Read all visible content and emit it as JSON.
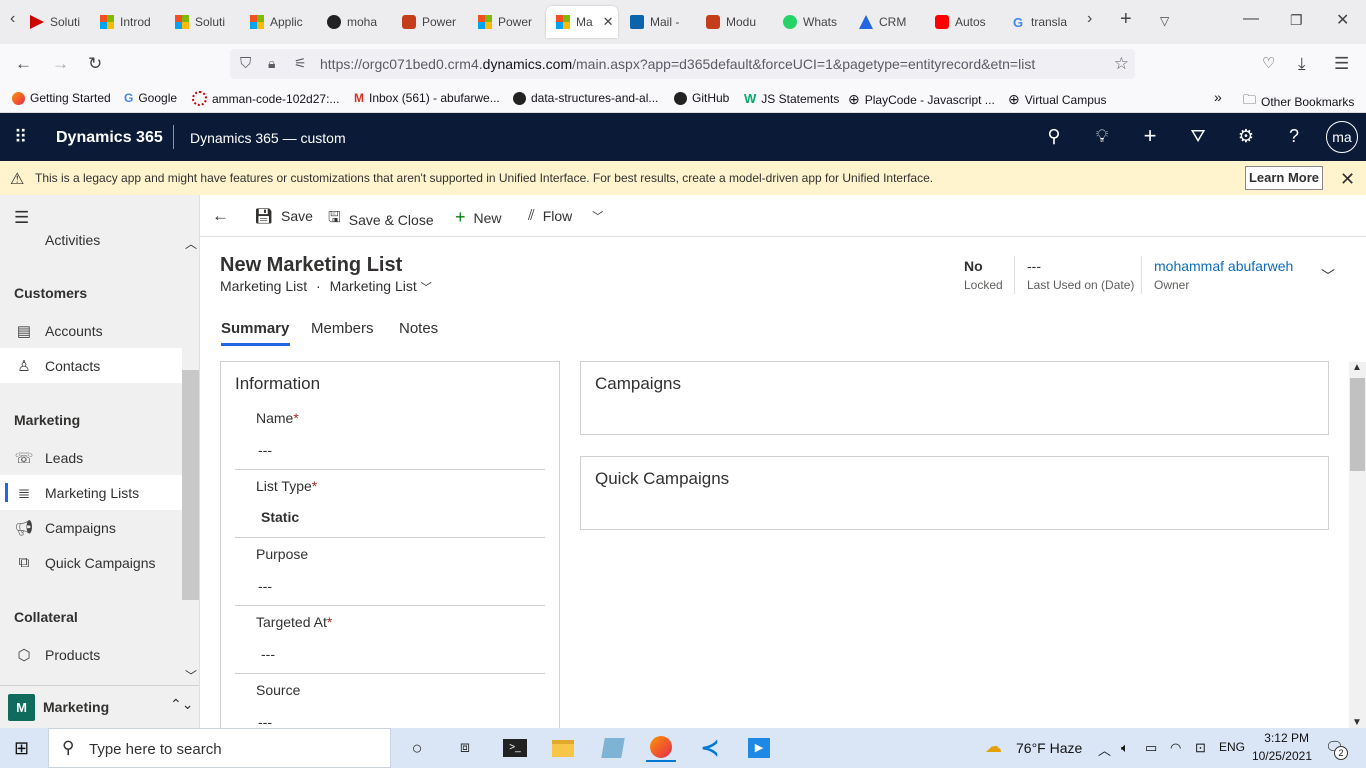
{
  "browser": {
    "tabs": [
      {
        "label": "Soluti",
        "icon": "powerapps-icon"
      },
      {
        "label": "Introd",
        "icon": "microsoft-icon"
      },
      {
        "label": "Soluti",
        "icon": "microsoft-icon"
      },
      {
        "label": "Applic",
        "icon": "microsoft-icon"
      },
      {
        "label": "moha",
        "icon": "github-icon"
      },
      {
        "label": "Power",
        "icon": "powerpoint-icon"
      },
      {
        "label": "Power",
        "icon": "microsoft-icon"
      },
      {
        "label": "Ma",
        "icon": "microsoft-icon",
        "active": true
      },
      {
        "label": "Mail -",
        "icon": "outlook-icon"
      },
      {
        "label": "Modu",
        "icon": "powerpoint-icon"
      },
      {
        "label": "Whats",
        "icon": "whatsapp-icon"
      },
      {
        "label": "CRM",
        "icon": "crm-icon"
      },
      {
        "label": "Autos",
        "icon": "youtube-icon"
      },
      {
        "label": "transla",
        "icon": "google-icon"
      }
    ],
    "url_prefix": "https://orgc071bed0.crm4.",
    "url_domain": "dynamics.com",
    "url_path": "/main.aspx?app=d365default&forceUCI=1&pagetype=entityrecord&etn=list",
    "bookmarks": [
      {
        "label": "Getting Started",
        "icon": "firefox-icon"
      },
      {
        "label": "Google",
        "icon": "google-icon"
      },
      {
        "label": "amman-code-102d27:...",
        "icon": "loading-icon"
      },
      {
        "label": "Inbox (561) - abufarwe...",
        "icon": "gmail-icon"
      },
      {
        "label": "data-structures-and-al...",
        "icon": "github-icon"
      },
      {
        "label": "GitHub",
        "icon": "github-icon"
      },
      {
        "label": "JS Statements",
        "icon": "w3schools-icon"
      },
      {
        "label": "PlayCode - Javascript ...",
        "icon": "globe-icon"
      },
      {
        "label": "Virtual Campus",
        "icon": "globe-icon"
      }
    ],
    "other_bookmarks": "Other Bookmarks"
  },
  "header": {
    "product": "Dynamics 365",
    "app": "Dynamics 365 — custom",
    "avatar": "ma"
  },
  "warning": {
    "text": "This is a legacy app and might have features or customizations that aren't supported in Unified Interface. For best results, create a model-driven app for Unified Interface.",
    "learn_more": "Learn More"
  },
  "sidebar": {
    "top_item": "Activities",
    "groups": [
      {
        "title": "Customers",
        "items": [
          "Accounts",
          "Contacts"
        ]
      },
      {
        "title": "Marketing",
        "items": [
          "Leads",
          "Marketing Lists",
          "Campaigns",
          "Quick Campaigns"
        ]
      },
      {
        "title": "Collateral",
        "items": [
          "Products"
        ]
      }
    ],
    "area_letter": "M",
    "area_name": "Marketing"
  },
  "commands": {
    "save": "Save",
    "save_close": "Save & Close",
    "new": "New",
    "flow": "Flow"
  },
  "form": {
    "title": "New Marketing List",
    "entity": "Marketing List",
    "form_name": "Marketing List",
    "header_fields": [
      {
        "value": "No",
        "label": "Locked"
      },
      {
        "value": "---",
        "label": "Last Used on (Date)"
      },
      {
        "value": "mohammaf abufarweh",
        "label": "Owner"
      }
    ],
    "tabs": [
      "Summary",
      "Members",
      "Notes"
    ],
    "info_section": "Information",
    "fields": [
      {
        "label": "Name",
        "required": "*",
        "value": "---"
      },
      {
        "label": "List Type",
        "required": "*",
        "value": "Static"
      },
      {
        "label": "Purpose",
        "required": "",
        "value": "---"
      },
      {
        "label": "Targeted At",
        "required": "*",
        "value": "---"
      },
      {
        "label": "Source",
        "required": "",
        "value": "---"
      }
    ],
    "campaigns_section": "Campaigns",
    "quick_campaigns_section": "Quick Campaigns"
  },
  "taskbar": {
    "search_placeholder": "Type here to search",
    "weather": "76°F  Haze",
    "lang": "ENG",
    "time": "3:12 PM",
    "date": "10/25/2021",
    "notifications": "2"
  },
  "colors": {
    "header_bg": "#0b1b37",
    "accent": "#2266e3",
    "warning_bg": "#fff4ce",
    "required": "#a4262c"
  }
}
